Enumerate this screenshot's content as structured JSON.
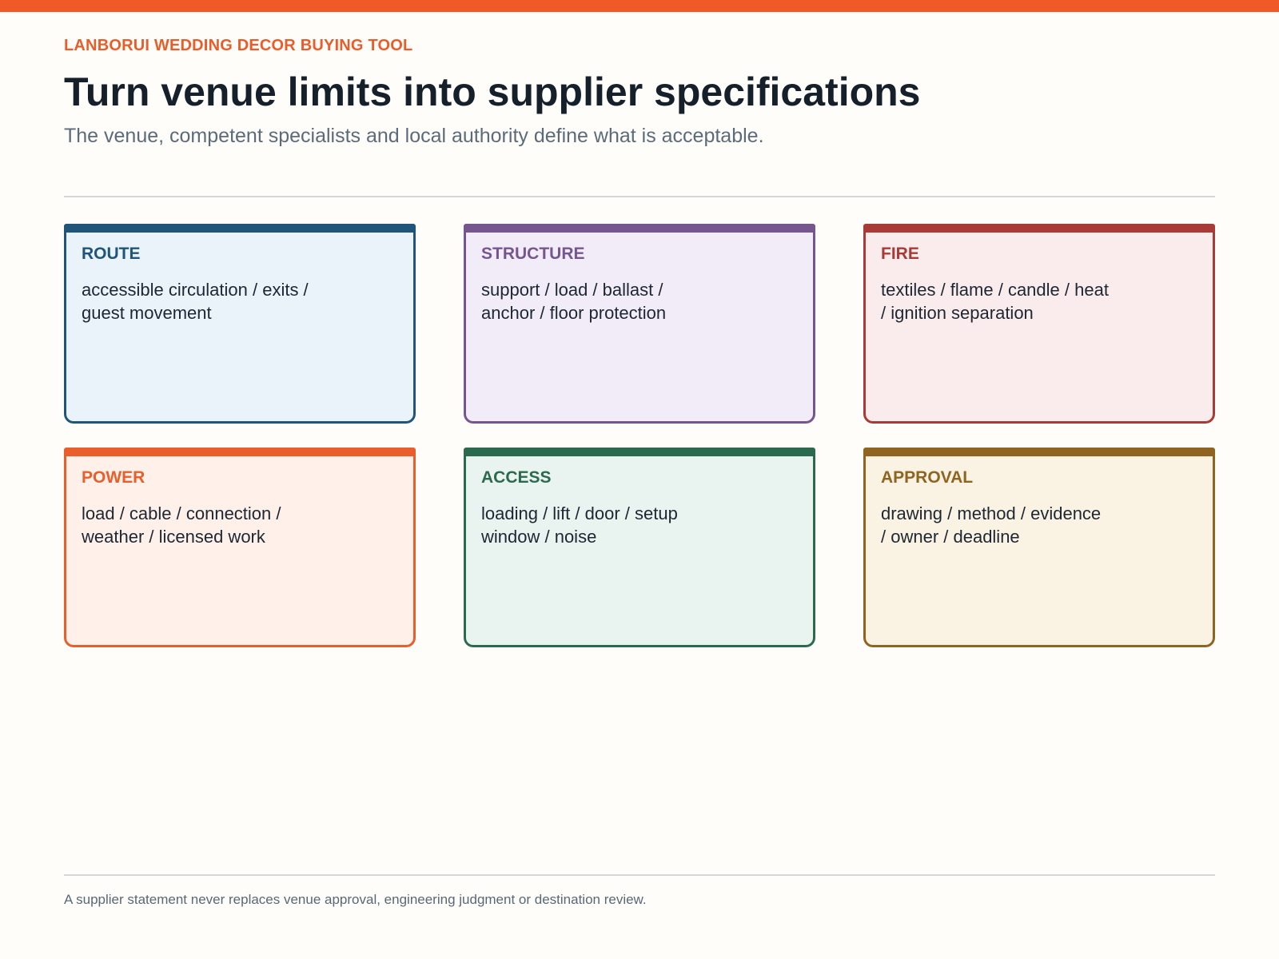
{
  "header": {
    "eyebrow": "LANBORUI WEDDING DECOR BUYING TOOL",
    "title": "Turn venue limits into supplier specifications",
    "subtitle": "The venue, competent specialists and local authority define what is acceptable."
  },
  "cards": [
    {
      "title": "ROUTE",
      "description": "accessible circulation / exits / guest movement",
      "color": "#1f5578"
    },
    {
      "title": "STRUCTURE",
      "description": "support / load / ballast / anchor / floor protection",
      "color": "#76568e"
    },
    {
      "title": "FIRE",
      "description": "textiles / flame / candle / heat / ignition separation",
      "color": "#a83b36"
    },
    {
      "title": "POWER",
      "description": "load / cable / connection / weather / licensed work",
      "color": "#ea5e2c"
    },
    {
      "title": "ACCESS",
      "description": "loading / lift / door / setup window / noise",
      "color": "#2c6a4f"
    },
    {
      "title": "APPROVAL",
      "description": "drawing / method / evidence / owner / deadline",
      "color": "#8e6420"
    }
  ],
  "footer": {
    "note": "A supplier statement never replaces venue approval, engineering judgment or destination review."
  },
  "colors": {
    "accent": "#f05a28",
    "heading": "#15202b",
    "muted": "#5b6b7a"
  }
}
